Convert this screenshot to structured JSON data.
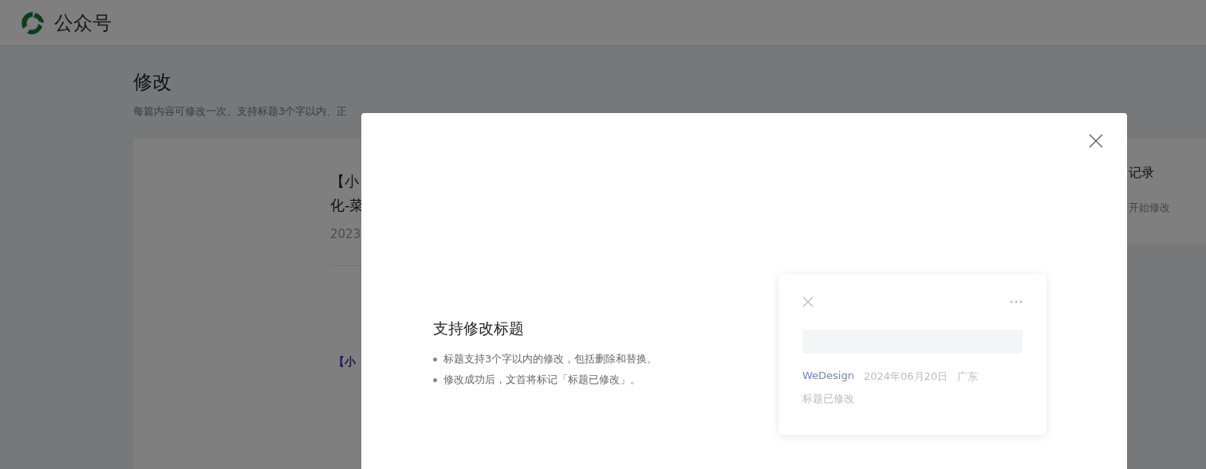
{
  "header": {
    "title": "公众号"
  },
  "page": {
    "title": "修改",
    "description": "每篇内容可修改一次。支持标题3个字以内、正"
  },
  "article": {
    "title_lines": [
      "【小",
      "化-菜"
    ],
    "date": "2023",
    "excerpt": "【小"
  },
  "side_card": {
    "title": "记录",
    "text": "开始修改"
  },
  "dialog": {
    "heading": "支持修改标题",
    "bullets": [
      "标题支持3个字以内的修改，包括删除和替换。",
      "修改成功后，文首将标记「标题已修改」。"
    ],
    "preview": {
      "author": "WeDesign",
      "date": "2024年06月20日",
      "location": "广东",
      "tag": "标题已修改"
    }
  }
}
